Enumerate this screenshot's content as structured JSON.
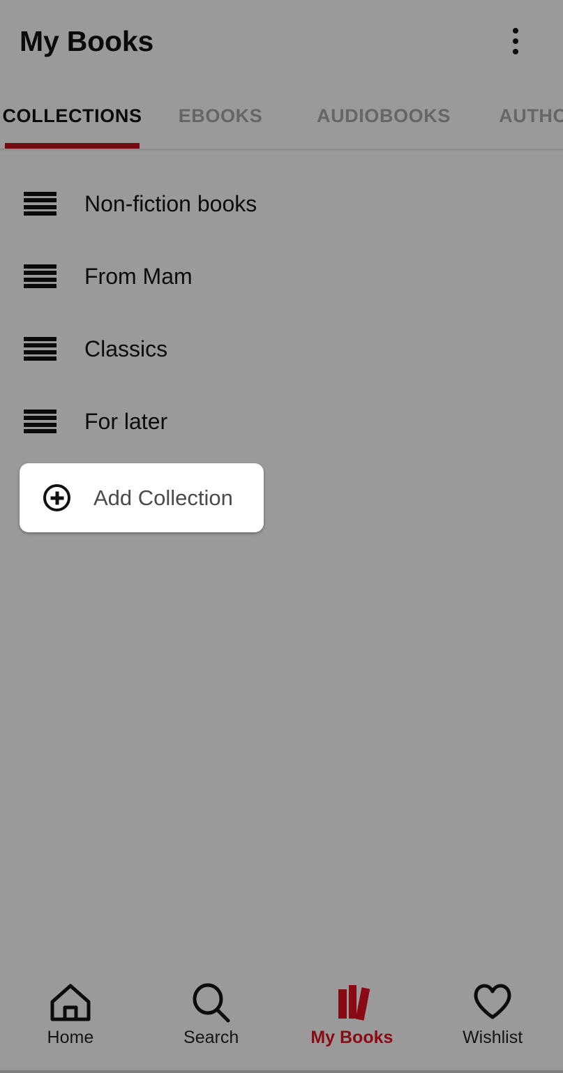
{
  "appbar": {
    "title": "My Books",
    "overflow_icon": "more-vertical-icon"
  },
  "tabs": {
    "active_index": 0,
    "indicator_color": "#760a11",
    "items": [
      {
        "label": "COLLECTIONS"
      },
      {
        "label": "EBOOKS"
      },
      {
        "label": "AUDIOBOOKS"
      },
      {
        "label": "AUTHORS"
      }
    ]
  },
  "collections": {
    "items": [
      {
        "label": "Non-fiction books",
        "handle_icon": "drag-handle-icon"
      },
      {
        "label": "From Mam",
        "handle_icon": "drag-handle-icon"
      },
      {
        "label": "Classics",
        "handle_icon": "drag-handle-icon"
      },
      {
        "label": "For later",
        "handle_icon": "drag-handle-icon"
      }
    ]
  },
  "add_collection": {
    "label": "Add Collection",
    "icon": "plus-circle-icon"
  },
  "bottom_nav": {
    "active_index": 2,
    "active_color": "#8a0a14",
    "items": [
      {
        "label": "Home",
        "icon": "home-icon"
      },
      {
        "label": "Search",
        "icon": "search-icon"
      },
      {
        "label": "My Books",
        "icon": "books-icon"
      },
      {
        "label": "Wishlist",
        "icon": "heart-icon"
      }
    ]
  }
}
